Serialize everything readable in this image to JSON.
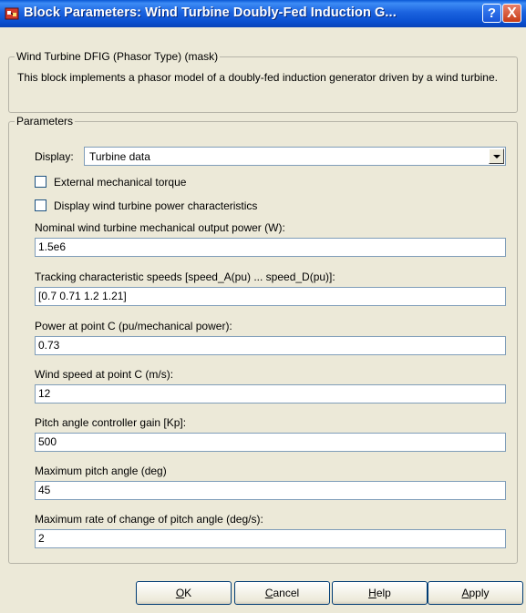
{
  "window": {
    "title": "Block Parameters: Wind Turbine Doubly-Fed Induction G...",
    "help_button": "?",
    "close_button": "X"
  },
  "mask": {
    "legend": "Wind Turbine DFIG (Phasor Type) (mask)",
    "description": "This block implements a phasor model of a doubly-fed induction generator driven by a wind turbine."
  },
  "parameters": {
    "legend": "Parameters",
    "display_label": "Display:",
    "display_value": "Turbine data",
    "external_torque_label": "External mechanical torque",
    "external_torque_checked": false,
    "display_power_label": "Display wind turbine power characteristics",
    "display_power_checked": false,
    "fields": [
      {
        "label": "Nominal wind turbine mechanical output power (W):",
        "value": "1.5e6"
      },
      {
        "label": "Tracking characteristic speeds [speed_A(pu) ... speed_D(pu)]:",
        "value": "[0.7 0.71 1.2 1.21]"
      },
      {
        "label": "Power at point C (pu/mechanical power):",
        "value": "0.73"
      },
      {
        "label": "Wind speed at point C (m/s):",
        "value": "12"
      },
      {
        "label": "Pitch angle controller gain [Kp]:",
        "value": "500"
      },
      {
        "label": "Maximum pitch angle (deg)",
        "value": "45"
      },
      {
        "label": "Maximum rate of change of pitch angle (deg/s):",
        "value": "2"
      }
    ]
  },
  "buttons": {
    "ok": {
      "first": "O",
      "rest": "K"
    },
    "cancel": {
      "first": "C",
      "rest": "ancel"
    },
    "help": {
      "first": "H",
      "rest": "elp"
    },
    "apply": {
      "first": "A",
      "rest": "pply"
    }
  },
  "colors": {
    "titlebar": "#0a4fd0",
    "window_bg": "#ece9d8",
    "input_border": "#7f9db9",
    "close_button": "#c83c17"
  }
}
